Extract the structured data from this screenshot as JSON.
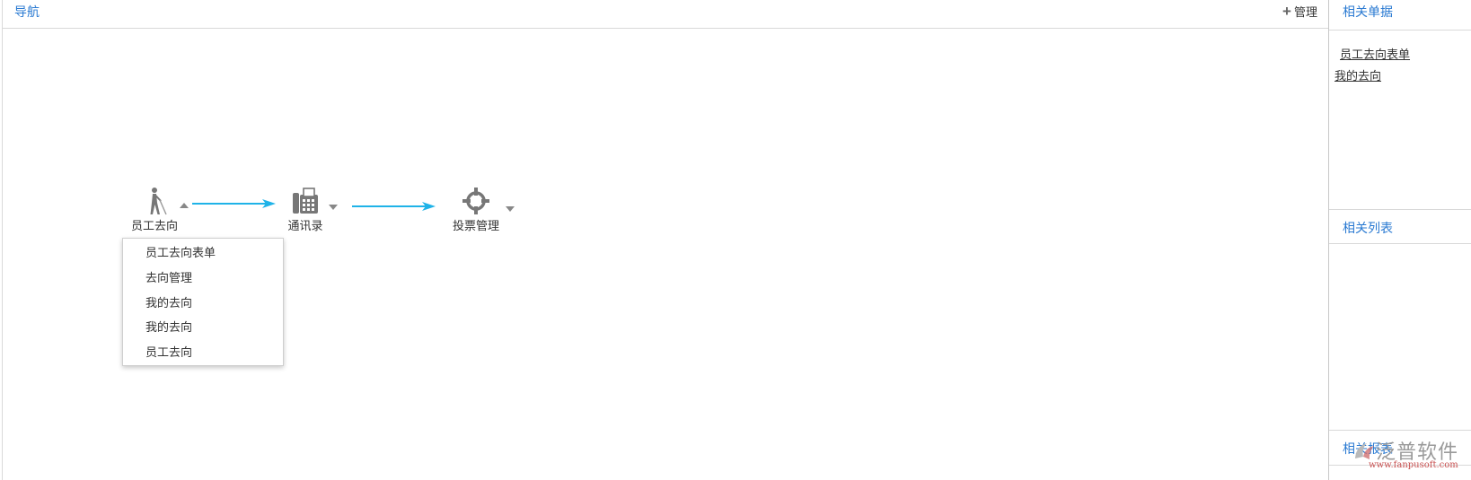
{
  "nav": {
    "title": "导航",
    "manage_label": "管理"
  },
  "flow": {
    "nodes": [
      {
        "label": "员工去向",
        "icon": "blind-walker-icon"
      },
      {
        "label": "通讯录",
        "icon": "fax-phone-icon"
      },
      {
        "label": "投票管理",
        "icon": "crosshair-target-icon"
      }
    ],
    "arrow_color": "#1fb3e8"
  },
  "dropdown": {
    "items": [
      "员工去向表单",
      "去向管理",
      "我的去向",
      "我的去向",
      "员工去向"
    ]
  },
  "side": {
    "related_forms_title": "相关单据",
    "related_forms": [
      "员工去向表单",
      "我的去向"
    ],
    "related_lists_title": "相关列表",
    "related_reports_title": "相关报表"
  },
  "watermark": {
    "name": "泛普软件",
    "url": "www.fanpusoft.com"
  },
  "colors": {
    "accent": "#2a7ad2",
    "border": "#d9d9d9",
    "icon_gray": "#777777"
  }
}
